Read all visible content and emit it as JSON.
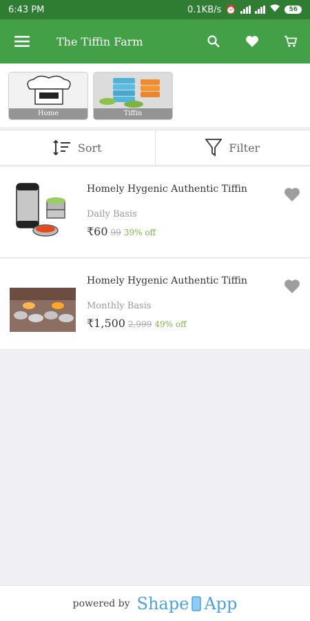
{
  "status": {
    "time": "6:43 PM",
    "speed": "0.1KB/s",
    "battery": "56"
  },
  "header": {
    "title": "The Tiffin Farm"
  },
  "categories": [
    {
      "label": "Home"
    },
    {
      "label": "Tiffin"
    }
  ],
  "toolbar": {
    "sort_label": "Sort",
    "filter_label": "Filter"
  },
  "products": [
    {
      "title": "Homely Hygenic Authentic Tiffin",
      "basis": "Daily Basis",
      "price": "₹60",
      "mrp": "99",
      "discount": "39% off"
    },
    {
      "title": "Homely Hygenic Authentic Tiffin",
      "basis": "Monthly Basis",
      "price": "₹1,500",
      "mrp": "2,999",
      "discount": "49% off"
    }
  ],
  "footer": {
    "powered_by": "powered by",
    "brand_left": "Shape",
    "brand_right": "App"
  },
  "colors": {
    "status_bar": "#2e7d32",
    "app_bar": "#43a047",
    "discount": "#7cb342",
    "brand": "#4aa3df"
  }
}
